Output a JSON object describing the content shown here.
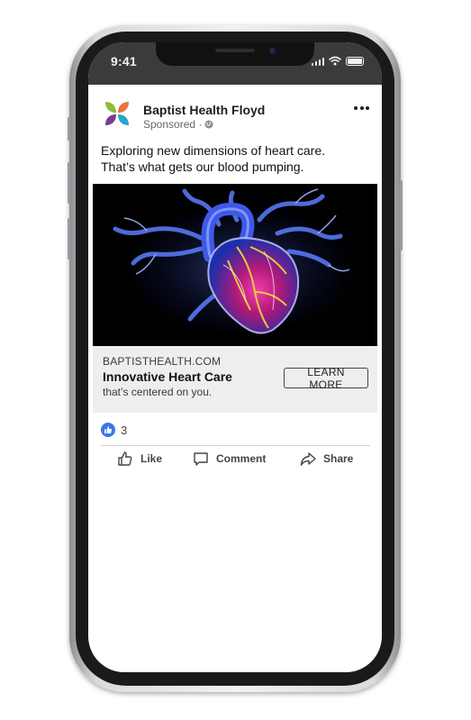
{
  "status_bar": {
    "time": "9:41"
  },
  "post": {
    "page_name": "Baptist Health Floyd",
    "sponsored_label": "Sponsored ·",
    "text_line1": "Exploring new dimensions of heart care.",
    "text_line2": "That’s what gets our blood pumping.",
    "media_description": "heart-illustration"
  },
  "link": {
    "domain": "BAPTISTHEALTH.COM",
    "headline": "Innovative Heart Care",
    "description": "that’s centered on you.",
    "cta_label": "LEARN MORE"
  },
  "reactions": {
    "count": "3",
    "icon": "like-icon"
  },
  "actions": [
    {
      "label": "Like",
      "icon": "thumbs-up-icon"
    },
    {
      "label": "Comment",
      "icon": "comment-icon"
    },
    {
      "label": "Share",
      "icon": "share-icon"
    }
  ],
  "colors": {
    "logo_green": "#8dbb3c",
    "logo_orange": "#e8743b",
    "logo_purple": "#7a3b8f",
    "logo_blue": "#2aa3c9",
    "like_blue": "#3b78e7"
  }
}
